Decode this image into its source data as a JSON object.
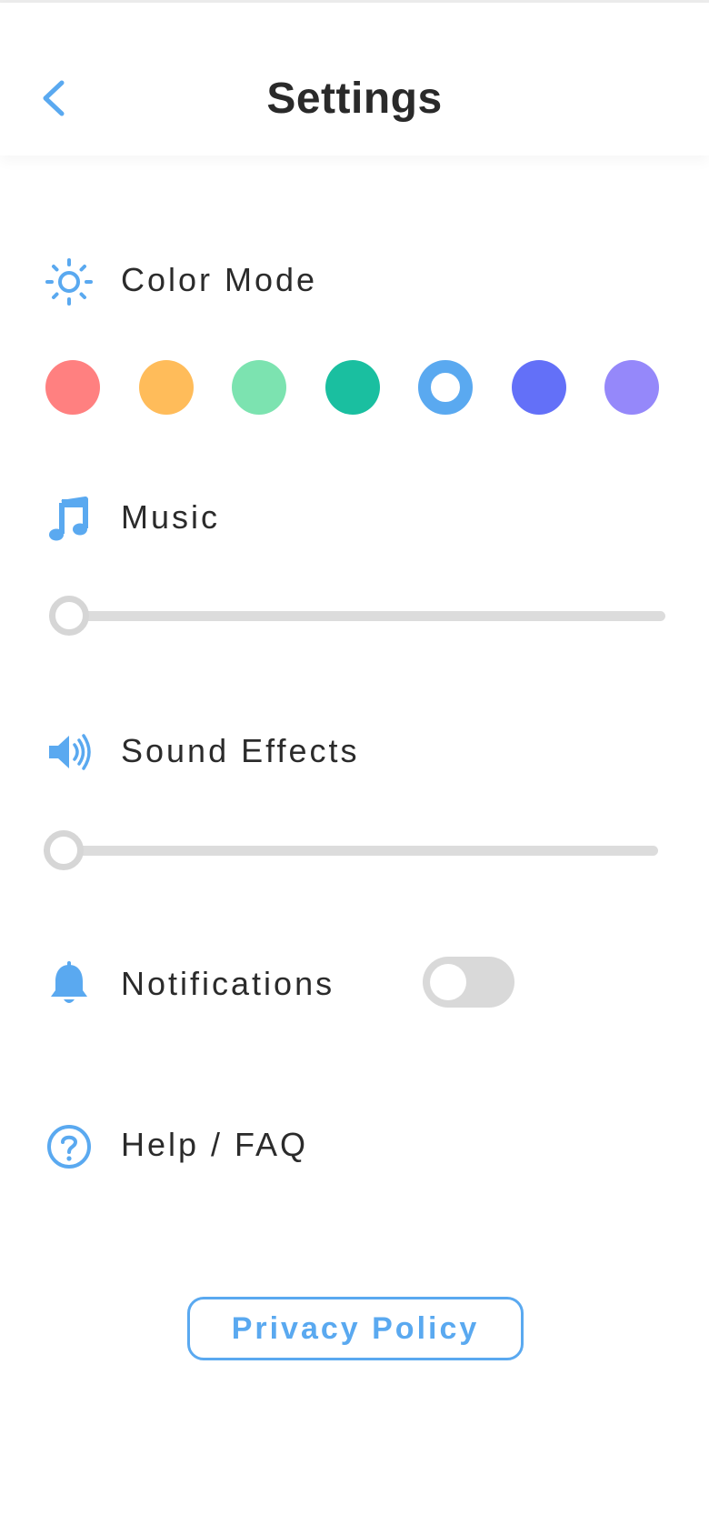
{
  "header": {
    "title": "Settings",
    "back_icon": "chevron-left-icon"
  },
  "colors": {
    "accent": "#5AA9F0",
    "text": "#2B2B2B",
    "track": "#DCDCDC"
  },
  "color_mode": {
    "label": "Color Mode",
    "icon": "sun-icon",
    "swatches": [
      {
        "color": "#FF8080",
        "selected": false
      },
      {
        "color": "#FFBC5A",
        "selected": false
      },
      {
        "color": "#7CE3B0",
        "selected": false
      },
      {
        "color": "#1ABFA0",
        "selected": false
      },
      {
        "color": "#5AA9F0",
        "selected": true
      },
      {
        "color": "#6370F8",
        "selected": false
      },
      {
        "color": "#9588FA",
        "selected": false
      }
    ]
  },
  "music": {
    "label": "Music",
    "icon": "music-note-icon",
    "volume_fraction": 0
  },
  "sound_effects": {
    "label": "Sound Effects",
    "icon": "speaker-icon",
    "volume_fraction": 0
  },
  "notifications": {
    "label": "Notifications",
    "icon": "bell-icon",
    "enabled": false
  },
  "help": {
    "label": "Help / FAQ",
    "icon": "question-circle-icon"
  },
  "privacy": {
    "label": "Privacy Policy"
  }
}
